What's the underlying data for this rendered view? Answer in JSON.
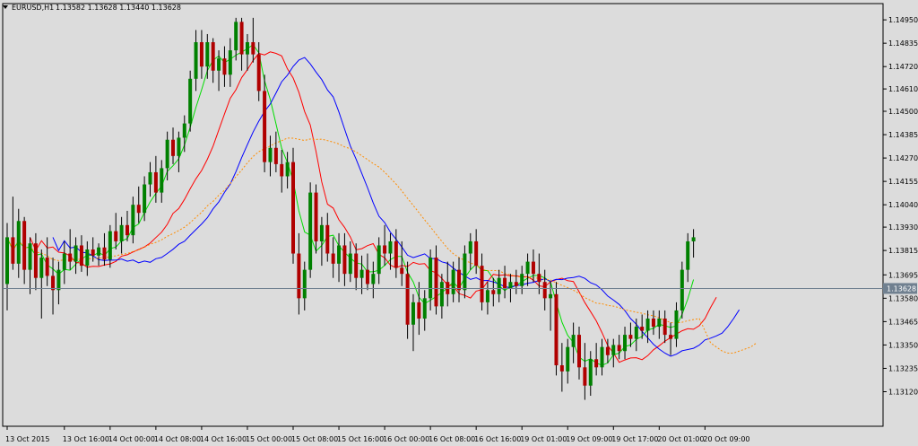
{
  "header": {
    "symbol": "EURUSD,H1",
    "ohlc": "1.13582 1.13628 1.13440 1.13628",
    "menu_icon": "triangle-down-icon"
  },
  "chart_data": {
    "type": "candlestick",
    "symbol": "EURUSD",
    "timeframe": "H1",
    "last_price": 1.13628,
    "price_label": "1.13628",
    "ylim": [
      1.1295,
      1.1503
    ],
    "ytick_values": [
      1.1495,
      1.14835,
      1.1472,
      1.1461,
      1.145,
      1.14385,
      1.1427,
      1.14155,
      1.1404,
      1.1393,
      1.13815,
      1.13695,
      1.1358,
      1.13465,
      1.1335,
      1.13235,
      1.1312
    ],
    "yticks": [
      "1.14950",
      "1.14835",
      "1.14720",
      "1.14610",
      "1.14500",
      "1.14385",
      "1.14270",
      "1.14155",
      "1.14040",
      "1.13930",
      "1.13815",
      "1.13695",
      "1.13580",
      "1.13465",
      "1.13350",
      "1.13235",
      "1.13120"
    ],
    "xticks": [
      {
        "label": "13 Oct 2015",
        "bar": 0
      },
      {
        "label": "13 Oct 16:00",
        "bar": 10
      },
      {
        "label": "14 Oct 00:00",
        "bar": 18
      },
      {
        "label": "14 Oct 08:00",
        "bar": 26
      },
      {
        "label": "14 Oct 16:00",
        "bar": 34
      },
      {
        "label": "15 Oct 00:00",
        "bar": 42
      },
      {
        "label": "15 Oct 08:00",
        "bar": 50
      },
      {
        "label": "15 Oct 16:00",
        "bar": 58
      },
      {
        "label": "16 Oct 00:00",
        "bar": 66
      },
      {
        "label": "16 Oct 08:00",
        "bar": 74
      },
      {
        "label": "16 Oct 16:00",
        "bar": 82
      },
      {
        "label": "19 Oct 01:00",
        "bar": 90
      },
      {
        "label": "19 Oct 09:00",
        "bar": 98
      },
      {
        "label": "19 Oct 17:00",
        "bar": 106
      },
      {
        "label": "20 Oct 01:00",
        "bar": 114
      },
      {
        "label": "20 Oct 09:00",
        "bar": 122
      }
    ],
    "colors": {
      "background": "#dcdcdc",
      "bull": "#008000",
      "bear": "#b00000",
      "wick": "#000000",
      "price_line": "#708090",
      "ma_fast": "#00dd00",
      "ma_mid": "#ff0000",
      "ma_slow": "#0000ff",
      "ma_long": "#ff8c00"
    },
    "candles": [
      [
        1.1365,
        1.1395,
        1.1352,
        1.1388
      ],
      [
        1.1388,
        1.1408,
        1.1372,
        1.1375
      ],
      [
        1.1375,
        1.1402,
        1.1368,
        1.1396
      ],
      [
        1.1396,
        1.1398,
        1.1365,
        1.1372
      ],
      [
        1.1372,
        1.1388,
        1.136,
        1.1385
      ],
      [
        1.1385,
        1.139,
        1.1362,
        1.1368
      ],
      [
        1.1368,
        1.1382,
        1.1348,
        1.1378
      ],
      [
        1.1378,
        1.1388,
        1.1364,
        1.1369
      ],
      [
        1.1369,
        1.1378,
        1.135,
        1.1362
      ],
      [
        1.1362,
        1.1376,
        1.1355,
        1.1372
      ],
      [
        1.1372,
        1.1386,
        1.1365,
        1.138
      ],
      [
        1.138,
        1.1392,
        1.1372,
        1.1376
      ],
      [
        1.1376,
        1.1388,
        1.137,
        1.1384
      ],
      [
        1.1384,
        1.1389,
        1.1371,
        1.1374
      ],
      [
        1.1374,
        1.1386,
        1.1369,
        1.1382
      ],
      [
        1.1382,
        1.1388,
        1.1376,
        1.1379
      ],
      [
        1.1379,
        1.1385,
        1.1374,
        1.1383
      ],
      [
        1.1383,
        1.139,
        1.1374,
        1.1377
      ],
      [
        1.1377,
        1.1394,
        1.1373,
        1.1391
      ],
      [
        1.1391,
        1.14,
        1.1382,
        1.1386
      ],
      [
        1.1386,
        1.1398,
        1.138,
        1.1394
      ],
      [
        1.1394,
        1.1401,
        1.1386,
        1.1389
      ],
      [
        1.1389,
        1.1408,
        1.1385,
        1.1404
      ],
      [
        1.1404,
        1.1413,
        1.1395,
        1.14
      ],
      [
        1.14,
        1.1418,
        1.1396,
        1.1414
      ],
      [
        1.1414,
        1.1425,
        1.1408,
        1.142
      ],
      [
        1.142,
        1.1428,
        1.1405,
        1.141
      ],
      [
        1.141,
        1.1426,
        1.1405,
        1.1422
      ],
      [
        1.1422,
        1.144,
        1.1416,
        1.1436
      ],
      [
        1.1436,
        1.1442,
        1.1424,
        1.1428
      ],
      [
        1.1428,
        1.144,
        1.142,
        1.1437
      ],
      [
        1.1437,
        1.1448,
        1.143,
        1.1444
      ],
      [
        1.1444,
        1.147,
        1.144,
        1.1466
      ],
      [
        1.1466,
        1.149,
        1.146,
        1.1484
      ],
      [
        1.1484,
        1.149,
        1.1466,
        1.1472
      ],
      [
        1.1472,
        1.1488,
        1.1466,
        1.1484
      ],
      [
        1.1484,
        1.1486,
        1.1464,
        1.147
      ],
      [
        1.147,
        1.148,
        1.146,
        1.1476
      ],
      [
        1.1476,
        1.1482,
        1.1462,
        1.1468
      ],
      [
        1.1468,
        1.1486,
        1.1462,
        1.148
      ],
      [
        1.148,
        1.1496,
        1.1475,
        1.1494
      ],
      [
        1.1494,
        1.1496,
        1.147,
        1.1478
      ],
      [
        1.1478,
        1.1488,
        1.147,
        1.1484
      ],
      [
        1.1484,
        1.1496,
        1.1474,
        1.1478
      ],
      [
        1.1478,
        1.1484,
        1.1455,
        1.146
      ],
      [
        1.146,
        1.1468,
        1.142,
        1.1425
      ],
      [
        1.1425,
        1.1438,
        1.1418,
        1.1432
      ],
      [
        1.1432,
        1.144,
        1.142,
        1.1424
      ],
      [
        1.1424,
        1.1431,
        1.141,
        1.1418
      ],
      [
        1.1418,
        1.143,
        1.1412,
        1.1425
      ],
      [
        1.1425,
        1.1432,
        1.1375,
        1.138
      ],
      [
        1.138,
        1.139,
        1.135,
        1.1358
      ],
      [
        1.1358,
        1.1376,
        1.1352,
        1.1372
      ],
      [
        1.1372,
        1.1415,
        1.1368,
        1.141
      ],
      [
        1.141,
        1.1414,
        1.138,
        1.1386
      ],
      [
        1.1386,
        1.1398,
        1.1374,
        1.1394
      ],
      [
        1.1394,
        1.14,
        1.1376,
        1.138
      ],
      [
        1.138,
        1.1388,
        1.1368,
        1.1375
      ],
      [
        1.1375,
        1.139,
        1.1366,
        1.1384
      ],
      [
        1.1384,
        1.139,
        1.1364,
        1.137
      ],
      [
        1.137,
        1.1386,
        1.1366,
        1.138
      ],
      [
        1.138,
        1.1385,
        1.1362,
        1.1368
      ],
      [
        1.1368,
        1.1379,
        1.136,
        1.1372
      ],
      [
        1.1372,
        1.138,
        1.1362,
        1.1365
      ],
      [
        1.1365,
        1.1376,
        1.1358,
        1.137
      ],
      [
        1.137,
        1.1388,
        1.1365,
        1.1384
      ],
      [
        1.1384,
        1.1394,
        1.1374,
        1.138
      ],
      [
        1.138,
        1.139,
        1.1372,
        1.1386
      ],
      [
        1.1386,
        1.1392,
        1.1368,
        1.1373
      ],
      [
        1.1373,
        1.1386,
        1.1364,
        1.137
      ],
      [
        1.137,
        1.1376,
        1.1338,
        1.1345
      ],
      [
        1.1345,
        1.136,
        1.1332,
        1.1356
      ],
      [
        1.1356,
        1.1366,
        1.134,
        1.1348
      ],
      [
        1.1348,
        1.1362,
        1.1342,
        1.1358
      ],
      [
        1.1358,
        1.1382,
        1.1352,
        1.1378
      ],
      [
        1.1378,
        1.1384,
        1.135,
        1.1354
      ],
      [
        1.1354,
        1.137,
        1.1348,
        1.1366
      ],
      [
        1.1366,
        1.1376,
        1.1354,
        1.136
      ],
      [
        1.136,
        1.1376,
        1.1356,
        1.1372
      ],
      [
        1.1372,
        1.1378,
        1.1356,
        1.1362
      ],
      [
        1.1362,
        1.1384,
        1.1358,
        1.138
      ],
      [
        1.138,
        1.139,
        1.1372,
        1.1386
      ],
      [
        1.1386,
        1.1392,
        1.137,
        1.1374
      ],
      [
        1.1374,
        1.138,
        1.1352,
        1.1356
      ],
      [
        1.1356,
        1.1366,
        1.135,
        1.1362
      ],
      [
        1.1362,
        1.1368,
        1.1354,
        1.136
      ],
      [
        1.136,
        1.1372,
        1.1356,
        1.1368
      ],
      [
        1.1368,
        1.1374,
        1.1358,
        1.1363
      ],
      [
        1.1363,
        1.137,
        1.1356,
        1.1366
      ],
      [
        1.1366,
        1.1372,
        1.136,
        1.1364
      ],
      [
        1.1364,
        1.1374,
        1.136,
        1.137
      ],
      [
        1.137,
        1.138,
        1.1364,
        1.1376
      ],
      [
        1.1376,
        1.1382,
        1.1366,
        1.137
      ],
      [
        1.137,
        1.138,
        1.136,
        1.1366
      ],
      [
        1.1366,
        1.1372,
        1.1352,
        1.1358
      ],
      [
        1.1358,
        1.1366,
        1.1342,
        1.136
      ],
      [
        1.136,
        1.1366,
        1.132,
        1.1325
      ],
      [
        1.1325,
        1.1336,
        1.1312,
        1.1322
      ],
      [
        1.1322,
        1.1338,
        1.1316,
        1.1334
      ],
      [
        1.1334,
        1.1346,
        1.1326,
        1.134
      ],
      [
        1.134,
        1.1344,
        1.1318,
        1.1324
      ],
      [
        1.1324,
        1.1336,
        1.1308,
        1.1315
      ],
      [
        1.1315,
        1.1332,
        1.131,
        1.1328
      ],
      [
        1.1328,
        1.1336,
        1.132,
        1.1324
      ],
      [
        1.1324,
        1.1338,
        1.132,
        1.1334
      ],
      [
        1.1334,
        1.1338,
        1.1326,
        1.133
      ],
      [
        1.133,
        1.1338,
        1.1324,
        1.1335
      ],
      [
        1.1335,
        1.134,
        1.1328,
        1.1332
      ],
      [
        1.1332,
        1.1344,
        1.1328,
        1.134
      ],
      [
        1.134,
        1.1346,
        1.1334,
        1.1338
      ],
      [
        1.1338,
        1.1348,
        1.1332,
        1.1344
      ],
      [
        1.1344,
        1.135,
        1.1338,
        1.1342
      ],
      [
        1.1342,
        1.1352,
        1.1336,
        1.1348
      ],
      [
        1.1348,
        1.1352,
        1.134,
        1.1344
      ],
      [
        1.1344,
        1.1352,
        1.1338,
        1.1348
      ],
      [
        1.1348,
        1.1352,
        1.1336,
        1.134
      ],
      [
        1.134,
        1.1346,
        1.133,
        1.1338
      ],
      [
        1.1338,
        1.1356,
        1.1334,
        1.1352
      ],
      [
        1.1352,
        1.1376,
        1.1348,
        1.1372
      ],
      [
        1.1372,
        1.139,
        1.1366,
        1.1386
      ],
      [
        1.1386,
        1.1392,
        1.1378,
        1.1388
      ]
    ],
    "ma_long_extension": [
      1.1348,
      1.1342,
      1.1336,
      1.1334,
      1.1332,
      1.1331,
      1.1331,
      1.1332,
      1.1333,
      1.1334,
      1.1336
    ],
    "indicators": [
      {
        "key": "ma_fast",
        "period": 5,
        "shift": 0,
        "dash": false
      },
      {
        "key": "ma_mid",
        "period": 8,
        "shift": 4,
        "dash": false
      },
      {
        "key": "ma_slow",
        "period": 13,
        "shift": 8,
        "dash": false
      },
      {
        "key": "ma_long",
        "period": 34,
        "shift": 0,
        "dash": true
      }
    ]
  }
}
